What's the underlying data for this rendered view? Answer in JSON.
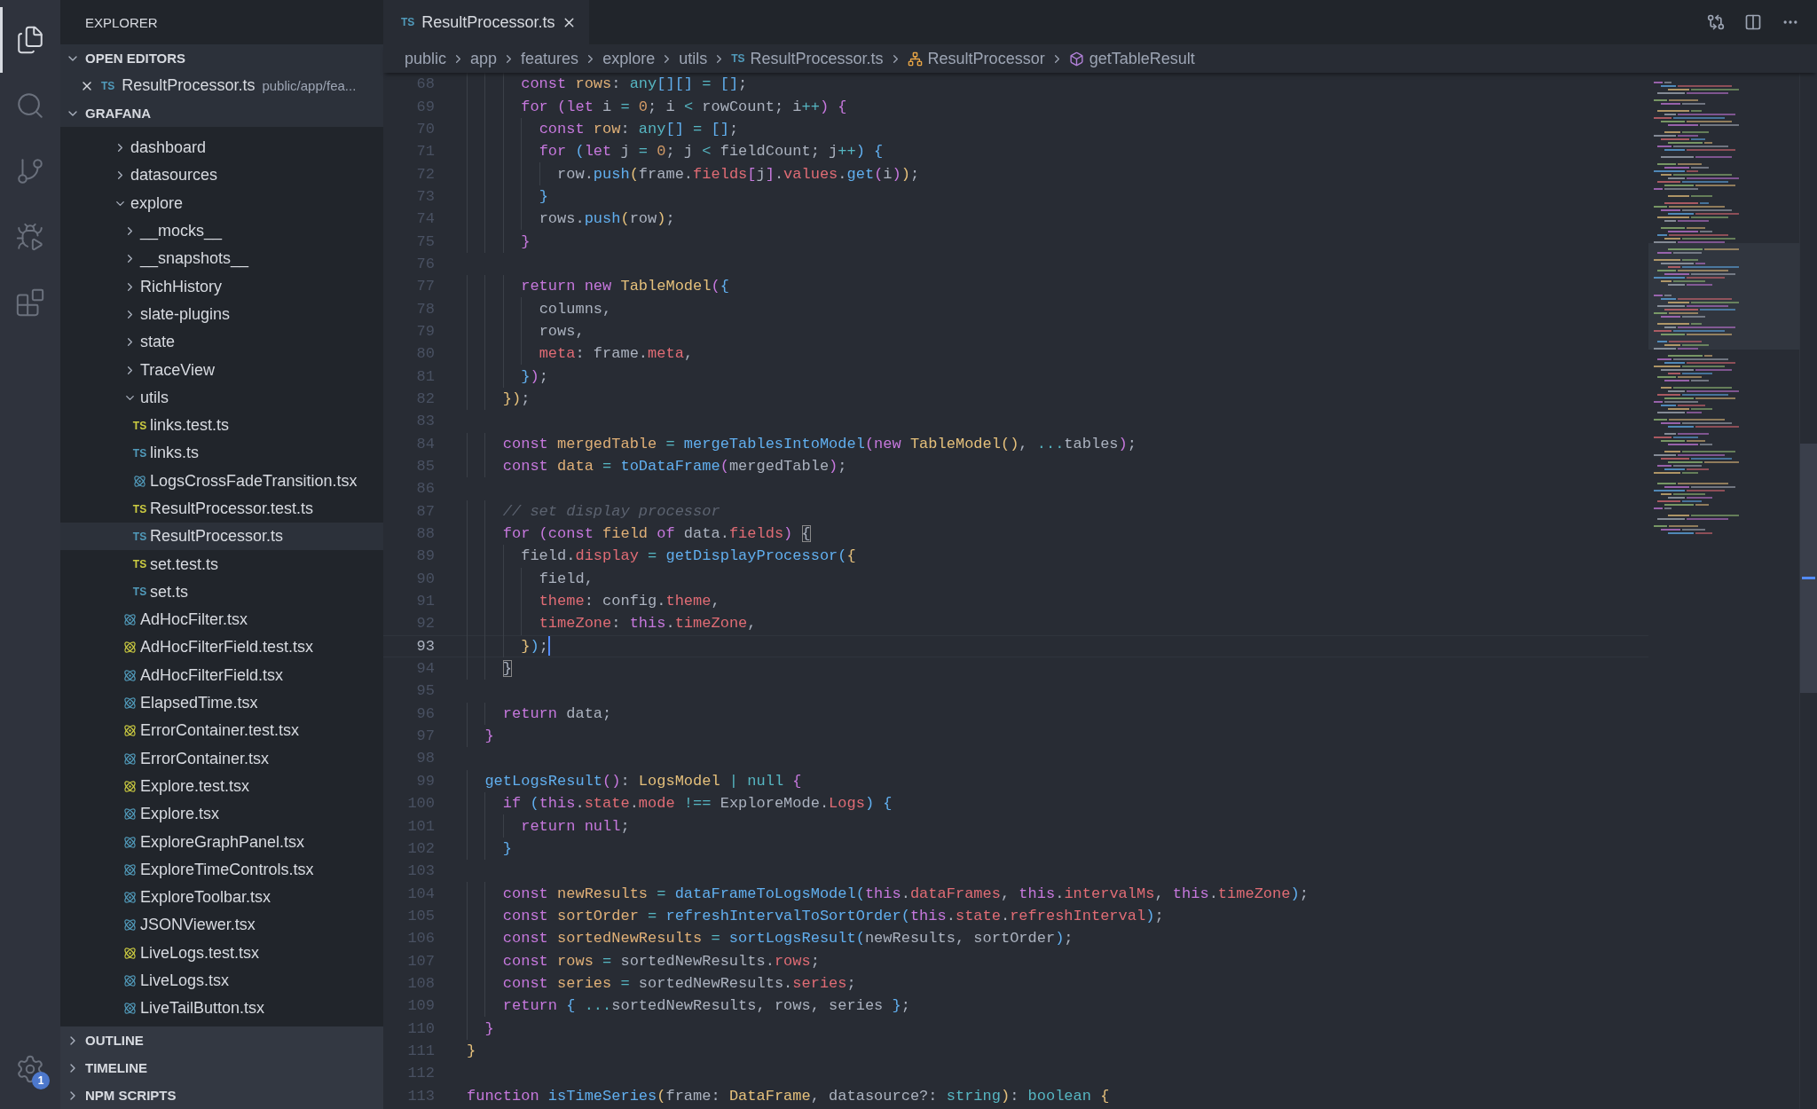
{
  "activity_bar": {
    "items": [
      {
        "kind": "files",
        "selected": true
      },
      {
        "kind": "search",
        "selected": false
      },
      {
        "kind": "source-control",
        "selected": false
      },
      {
        "kind": "run",
        "selected": false
      },
      {
        "kind": "extensions",
        "selected": false
      }
    ],
    "settings_badge": "1"
  },
  "sidebar": {
    "title": "EXPLORER",
    "sections": [
      {
        "kind": "open-editors",
        "title": "OPEN EDITORS",
        "expanded": true,
        "items": [
          {
            "badge": "TS",
            "name": "ResultProcessor.ts",
            "path": "public/app/fea..."
          }
        ]
      },
      {
        "kind": "tree",
        "title": "GRAFANA",
        "expanded": true,
        "tree": [
          {
            "kind": "folder",
            "name": "dashboard",
            "expanded": false,
            "selected": false
          },
          {
            "kind": "folder",
            "name": "datasources",
            "expanded": false,
            "selected": false
          },
          {
            "kind": "folder",
            "name": "explore",
            "expanded": true,
            "selected": false,
            "children": [
              {
                "kind": "folder",
                "name": "__mocks__",
                "expanded": false,
                "selected": false
              },
              {
                "kind": "folder",
                "name": "__snapshots__",
                "expanded": false,
                "selected": false
              },
              {
                "kind": "folder",
                "name": "RichHistory",
                "expanded": false,
                "selected": false
              },
              {
                "kind": "folder",
                "name": "slate-plugins",
                "expanded": false,
                "selected": false
              },
              {
                "kind": "folder",
                "name": "state",
                "expanded": false,
                "selected": false
              },
              {
                "kind": "folder",
                "name": "TraceView",
                "expanded": false,
                "selected": false
              },
              {
                "kind": "folder",
                "name": "utils",
                "expanded": true,
                "selected": false,
                "children": [
                  {
                    "kind": "ts-test",
                    "badge": "TS",
                    "name": "links.test.ts",
                    "selected": false
                  },
                  {
                    "kind": "ts",
                    "badge": "TS",
                    "name": "links.ts",
                    "selected": false
                  },
                  {
                    "kind": "tsx",
                    "name": "LogsCrossFadeTransition.tsx",
                    "selected": false
                  },
                  {
                    "kind": "ts-test",
                    "badge": "TS",
                    "name": "ResultProcessor.test.ts",
                    "selected": false
                  },
                  {
                    "kind": "ts",
                    "badge": "TS",
                    "name": "ResultProcessor.ts",
                    "selected": true
                  },
                  {
                    "kind": "ts-test",
                    "badge": "TS",
                    "name": "set.test.ts",
                    "selected": false
                  },
                  {
                    "kind": "ts",
                    "badge": "TS",
                    "name": "set.ts",
                    "selected": false
                  }
                ]
              },
              {
                "kind": "tsx",
                "name": "AdHocFilter.tsx",
                "selected": false
              },
              {
                "kind": "tsx-test",
                "name": "AdHocFilterField.test.tsx",
                "selected": false
              },
              {
                "kind": "tsx",
                "name": "AdHocFilterField.tsx",
                "selected": false
              },
              {
                "kind": "tsx",
                "name": "ElapsedTime.tsx",
                "selected": false
              },
              {
                "kind": "tsx-test",
                "name": "ErrorContainer.test.tsx",
                "selected": false
              },
              {
                "kind": "tsx",
                "name": "ErrorContainer.tsx",
                "selected": false
              },
              {
                "kind": "tsx-test",
                "name": "Explore.test.tsx",
                "selected": false
              },
              {
                "kind": "tsx",
                "name": "Explore.tsx",
                "selected": false
              },
              {
                "kind": "tsx",
                "name": "ExploreGraphPanel.tsx",
                "selected": false
              },
              {
                "kind": "tsx",
                "name": "ExploreTimeControls.tsx",
                "selected": false
              },
              {
                "kind": "tsx",
                "name": "ExploreToolbar.tsx",
                "selected": false
              },
              {
                "kind": "tsx",
                "name": "JSONViewer.tsx",
                "selected": false
              },
              {
                "kind": "tsx-test",
                "name": "LiveLogs.test.tsx",
                "selected": false
              },
              {
                "kind": "tsx",
                "name": "LiveLogs.tsx",
                "selected": false
              },
              {
                "kind": "tsx",
                "name": "LiveTailButton.tsx",
                "selected": false
              }
            ]
          }
        ]
      },
      {
        "kind": "panel",
        "title": "OUTLINE",
        "expanded": false
      },
      {
        "kind": "panel",
        "title": "TIMELINE",
        "expanded": false
      },
      {
        "kind": "panel",
        "title": "NPM SCRIPTS",
        "expanded": false
      }
    ]
  },
  "editor": {
    "tabs": [
      {
        "badge": "TS",
        "label": "ResultProcessor.ts",
        "selected": true
      }
    ],
    "breadcrumbs": [
      {
        "kind": "folder",
        "label": "public"
      },
      {
        "kind": "folder",
        "label": "app"
      },
      {
        "kind": "folder",
        "label": "features"
      },
      {
        "kind": "folder",
        "label": "explore"
      },
      {
        "kind": "folder",
        "label": "utils"
      },
      {
        "kind": "file",
        "badge": "TS",
        "label": "ResultProcessor.ts"
      },
      {
        "kind": "class",
        "label": "ResultProcessor"
      },
      {
        "kind": "method",
        "label": "getTableResult"
      }
    ],
    "lines": [
      {
        "number": "68",
        "tokens": [
          {
            "kind": "keyword",
            "text": "      const"
          },
          {
            "kind": "var",
            "text": " rows"
          },
          {
            "kind": "plain",
            "text": ": "
          },
          {
            "kind": "builtin",
            "text": "any"
          },
          {
            "kind": "paren2",
            "text": "[][]"
          },
          {
            "kind": "op",
            "text": " ="
          },
          {
            "kind": "paren2",
            "text": " []"
          },
          {
            "kind": "plain",
            "text": ";"
          }
        ]
      },
      {
        "number": "69",
        "tokens": [
          {
            "kind": "keyword",
            "text": "      for"
          },
          {
            "kind": "paren1",
            "text": " ("
          },
          {
            "kind": "keyword",
            "text": "let"
          },
          {
            "kind": "plain",
            "text": " i "
          },
          {
            "kind": "op",
            "text": "="
          },
          {
            "kind": "num",
            "text": " 0"
          },
          {
            "kind": "plain",
            "text": "; i "
          },
          {
            "kind": "op",
            "text": "<"
          },
          {
            "kind": "plain",
            "text": " rowCount; i"
          },
          {
            "kind": "op",
            "text": "++"
          },
          {
            "kind": "paren1",
            "text": ")"
          },
          {
            "kind": "paren1",
            "text": " {"
          }
        ]
      },
      {
        "number": "70",
        "tokens": [
          {
            "kind": "keyword",
            "text": "        const"
          },
          {
            "kind": "var",
            "text": " row"
          },
          {
            "kind": "plain",
            "text": ": "
          },
          {
            "kind": "builtin",
            "text": "any"
          },
          {
            "kind": "paren2",
            "text": "[]"
          },
          {
            "kind": "op",
            "text": " ="
          },
          {
            "kind": "paren2",
            "text": " []"
          },
          {
            "kind": "plain",
            "text": ";"
          }
        ]
      },
      {
        "number": "71",
        "tokens": [
          {
            "kind": "keyword",
            "text": "        for"
          },
          {
            "kind": "paren2",
            "text": " ("
          },
          {
            "kind": "keyword",
            "text": "let"
          },
          {
            "kind": "plain",
            "text": " j "
          },
          {
            "kind": "op",
            "text": "="
          },
          {
            "kind": "num",
            "text": " 0"
          },
          {
            "kind": "plain",
            "text": "; j "
          },
          {
            "kind": "op",
            "text": "<"
          },
          {
            "kind": "plain",
            "text": " fieldCount; j"
          },
          {
            "kind": "op",
            "text": "++"
          },
          {
            "kind": "paren2",
            "text": ")"
          },
          {
            "kind": "paren2",
            "text": " {"
          }
        ]
      },
      {
        "number": "72",
        "tokens": [
          {
            "kind": "plain",
            "text": "          row."
          },
          {
            "kind": "func",
            "text": "push"
          },
          {
            "kind": "paren3",
            "text": "("
          },
          {
            "kind": "plain",
            "text": "frame."
          },
          {
            "kind": "prop",
            "text": "fields"
          },
          {
            "kind": "paren1",
            "text": "["
          },
          {
            "kind": "plain",
            "text": "j"
          },
          {
            "kind": "paren1",
            "text": "]"
          },
          {
            "kind": "plain",
            "text": "."
          },
          {
            "kind": "prop",
            "text": "values"
          },
          {
            "kind": "plain",
            "text": "."
          },
          {
            "kind": "func",
            "text": "get"
          },
          {
            "kind": "paren1",
            "text": "("
          },
          {
            "kind": "plain",
            "text": "i"
          },
          {
            "kind": "paren1",
            "text": ")"
          },
          {
            "kind": "paren3",
            "text": ")"
          },
          {
            "kind": "plain",
            "text": ";"
          }
        ]
      },
      {
        "number": "73",
        "tokens": [
          {
            "kind": "paren2",
            "text": "        }"
          }
        ]
      },
      {
        "number": "74",
        "tokens": [
          {
            "kind": "plain",
            "text": "        rows."
          },
          {
            "kind": "func",
            "text": "push"
          },
          {
            "kind": "paren3",
            "text": "("
          },
          {
            "kind": "plain",
            "text": "row"
          },
          {
            "kind": "paren3",
            "text": ")"
          },
          {
            "kind": "plain",
            "text": ";"
          }
        ]
      },
      {
        "number": "75",
        "tokens": [
          {
            "kind": "paren1",
            "text": "      }"
          }
        ]
      },
      {
        "number": "76"
      },
      {
        "number": "77",
        "tokens": [
          {
            "kind": "keyword",
            "text": "      return"
          },
          {
            "kind": "keyword",
            "text": " new"
          },
          {
            "kind": "type",
            "text": " TableModel"
          },
          {
            "kind": "paren1",
            "text": "("
          },
          {
            "kind": "paren2",
            "text": "{"
          }
        ]
      },
      {
        "number": "78",
        "tokens": [
          {
            "kind": "plain",
            "text": "        columns,"
          }
        ]
      },
      {
        "number": "79",
        "tokens": [
          {
            "kind": "plain",
            "text": "        rows,"
          }
        ]
      },
      {
        "number": "80",
        "tokens": [
          {
            "kind": "prop",
            "text": "        meta"
          },
          {
            "kind": "plain",
            "text": ": frame."
          },
          {
            "kind": "prop",
            "text": "meta"
          },
          {
            "kind": "plain",
            "text": ","
          }
        ]
      },
      {
        "number": "81",
        "tokens": [
          {
            "kind": "paren2",
            "text": "      }"
          },
          {
            "kind": "paren1",
            "text": ")"
          },
          {
            "kind": "plain",
            "text": ";"
          }
        ]
      },
      {
        "number": "82",
        "tokens": [
          {
            "kind": "paren3",
            "text": "    })"
          },
          {
            "kind": "plain",
            "text": ";"
          }
        ]
      },
      {
        "number": "83"
      },
      {
        "number": "84",
        "tokens": [
          {
            "kind": "keyword",
            "text": "    const"
          },
          {
            "kind": "var",
            "text": " mergedTable"
          },
          {
            "kind": "op",
            "text": " ="
          },
          {
            "kind": "func",
            "text": " mergeTablesIntoModel"
          },
          {
            "kind": "paren1",
            "text": "("
          },
          {
            "kind": "keyword",
            "text": "new"
          },
          {
            "kind": "type",
            "text": " TableModel"
          },
          {
            "kind": "paren3",
            "text": "()"
          },
          {
            "kind": "plain",
            "text": ", "
          },
          {
            "kind": "op",
            "text": "..."
          },
          {
            "kind": "plain",
            "text": "tables"
          },
          {
            "kind": "paren1",
            "text": ")"
          },
          {
            "kind": "plain",
            "text": ";"
          }
        ]
      },
      {
        "number": "85",
        "tokens": [
          {
            "kind": "keyword",
            "text": "    const"
          },
          {
            "kind": "var",
            "text": " data"
          },
          {
            "kind": "op",
            "text": " ="
          },
          {
            "kind": "func",
            "text": " toDataFrame"
          },
          {
            "kind": "paren1",
            "text": "("
          },
          {
            "kind": "plain",
            "text": "mergedTable"
          },
          {
            "kind": "paren1",
            "text": ")"
          },
          {
            "kind": "plain",
            "text": ";"
          }
        ]
      },
      {
        "number": "86"
      },
      {
        "number": "87",
        "tokens": [
          {
            "kind": "comment",
            "text": "    // set display processor"
          }
        ]
      },
      {
        "number": "88",
        "tokens": [
          {
            "kind": "keyword",
            "text": "    for"
          },
          {
            "kind": "paren1",
            "text": " ("
          },
          {
            "kind": "keyword",
            "text": "const"
          },
          {
            "kind": "var",
            "text": " field"
          },
          {
            "kind": "keyword",
            "text": " of"
          },
          {
            "kind": "plain",
            "text": " data."
          },
          {
            "kind": "prop",
            "text": "fields"
          },
          {
            "kind": "paren1",
            "text": ") "
          },
          {
            "kind": "match",
            "text": "{"
          }
        ]
      },
      {
        "number": "89",
        "tokens": [
          {
            "kind": "plain",
            "text": "      field."
          },
          {
            "kind": "prop",
            "text": "display"
          },
          {
            "kind": "op",
            "text": " ="
          },
          {
            "kind": "func",
            "text": " getDisplayProcessor"
          },
          {
            "kind": "paren2",
            "text": "("
          },
          {
            "kind": "paren3",
            "text": "{"
          }
        ]
      },
      {
        "number": "90",
        "tokens": [
          {
            "kind": "plain",
            "text": "        field,"
          }
        ]
      },
      {
        "number": "91",
        "tokens": [
          {
            "kind": "prop",
            "text": "        theme"
          },
          {
            "kind": "plain",
            "text": ": config."
          },
          {
            "kind": "prop",
            "text": "theme"
          },
          {
            "kind": "plain",
            "text": ","
          }
        ]
      },
      {
        "number": "92",
        "tokens": [
          {
            "kind": "prop",
            "text": "        timeZone"
          },
          {
            "kind": "plain",
            "text": ": "
          },
          {
            "kind": "keyword",
            "text": "this"
          },
          {
            "kind": "plain",
            "text": "."
          },
          {
            "kind": "prop",
            "text": "timeZone"
          },
          {
            "kind": "plain",
            "text": ","
          }
        ]
      },
      {
        "number": "93",
        "current": true,
        "tokens": [
          {
            "kind": "paren3",
            "text": "      }"
          },
          {
            "kind": "paren2",
            "text": ")"
          },
          {
            "kind": "plain",
            "text": ";"
          }
        ]
      },
      {
        "number": "94",
        "tokens": [
          {
            "kind": "match",
            "text": "    }"
          }
        ]
      },
      {
        "number": "95"
      },
      {
        "number": "96",
        "tokens": [
          {
            "kind": "keyword",
            "text": "    return"
          },
          {
            "kind": "plain",
            "text": " data;"
          }
        ]
      },
      {
        "number": "97",
        "tokens": [
          {
            "kind": "paren1",
            "text": "  }"
          }
        ]
      },
      {
        "number": "98"
      },
      {
        "number": "99",
        "tokens": [
          {
            "kind": "func",
            "text": "  getLogsResult"
          },
          {
            "kind": "paren1",
            "text": "()"
          },
          {
            "kind": "plain",
            "text": ": "
          },
          {
            "kind": "type",
            "text": "LogsModel"
          },
          {
            "kind": "op",
            "text": " |"
          },
          {
            "kind": "builtin",
            "text": " null"
          },
          {
            "kind": "paren1",
            "text": " {"
          }
        ]
      },
      {
        "number": "100",
        "tokens": [
          {
            "kind": "keyword",
            "text": "    if"
          },
          {
            "kind": "paren2",
            "text": " ("
          },
          {
            "kind": "keyword",
            "text": "this"
          },
          {
            "kind": "plain",
            "text": "."
          },
          {
            "kind": "prop",
            "text": "state"
          },
          {
            "kind": "plain",
            "text": "."
          },
          {
            "kind": "prop",
            "text": "mode"
          },
          {
            "kind": "op",
            "text": " !=="
          },
          {
            "kind": "plain",
            "text": " ExploreMode."
          },
          {
            "kind": "prop",
            "text": "Logs"
          },
          {
            "kind": "paren2",
            "text": ")"
          },
          {
            "kind": "paren2",
            "text": " {"
          }
        ]
      },
      {
        "number": "101",
        "tokens": [
          {
            "kind": "keyword",
            "text": "      return"
          },
          {
            "kind": "keyword",
            "text": " null"
          },
          {
            "kind": "plain",
            "text": ";"
          }
        ]
      },
      {
        "number": "102",
        "tokens": [
          {
            "kind": "paren2",
            "text": "    }"
          }
        ]
      },
      {
        "number": "103"
      },
      {
        "number": "104",
        "tokens": [
          {
            "kind": "keyword",
            "text": "    const"
          },
          {
            "kind": "var",
            "text": " newResults"
          },
          {
            "kind": "op",
            "text": " ="
          },
          {
            "kind": "func",
            "text": " dataFrameToLogsModel"
          },
          {
            "kind": "paren2",
            "text": "("
          },
          {
            "kind": "keyword",
            "text": "this"
          },
          {
            "kind": "plain",
            "text": "."
          },
          {
            "kind": "prop",
            "text": "dataFrames"
          },
          {
            "kind": "plain",
            "text": ", "
          },
          {
            "kind": "keyword",
            "text": "this"
          },
          {
            "kind": "plain",
            "text": "."
          },
          {
            "kind": "prop",
            "text": "intervalMs"
          },
          {
            "kind": "plain",
            "text": ", "
          },
          {
            "kind": "keyword",
            "text": "this"
          },
          {
            "kind": "plain",
            "text": "."
          },
          {
            "kind": "prop",
            "text": "timeZone"
          },
          {
            "kind": "paren2",
            "text": ")"
          },
          {
            "kind": "plain",
            "text": ";"
          }
        ]
      },
      {
        "number": "105",
        "tokens": [
          {
            "kind": "keyword",
            "text": "    const"
          },
          {
            "kind": "var",
            "text": " sortOrder"
          },
          {
            "kind": "op",
            "text": " ="
          },
          {
            "kind": "func",
            "text": " refreshIntervalToSortOrder"
          },
          {
            "kind": "paren2",
            "text": "("
          },
          {
            "kind": "keyword",
            "text": "this"
          },
          {
            "kind": "plain",
            "text": "."
          },
          {
            "kind": "prop",
            "text": "state"
          },
          {
            "kind": "plain",
            "text": "."
          },
          {
            "kind": "prop",
            "text": "refreshInterval"
          },
          {
            "kind": "paren2",
            "text": ")"
          },
          {
            "kind": "plain",
            "text": ";"
          }
        ]
      },
      {
        "number": "106",
        "tokens": [
          {
            "kind": "keyword",
            "text": "    const"
          },
          {
            "kind": "var",
            "text": " sortedNewResults"
          },
          {
            "kind": "op",
            "text": " ="
          },
          {
            "kind": "func",
            "text": " sortLogsResult"
          },
          {
            "kind": "paren2",
            "text": "("
          },
          {
            "kind": "plain",
            "text": "newResults, sortOrder"
          },
          {
            "kind": "paren2",
            "text": ")"
          },
          {
            "kind": "plain",
            "text": ";"
          }
        ]
      },
      {
        "number": "107",
        "tokens": [
          {
            "kind": "keyword",
            "text": "    const"
          },
          {
            "kind": "var",
            "text": " rows"
          },
          {
            "kind": "op",
            "text": " ="
          },
          {
            "kind": "plain",
            "text": " sortedNewResults."
          },
          {
            "kind": "prop",
            "text": "rows"
          },
          {
            "kind": "plain",
            "text": ";"
          }
        ]
      },
      {
        "number": "108",
        "tokens": [
          {
            "kind": "keyword",
            "text": "    const"
          },
          {
            "kind": "var",
            "text": " series"
          },
          {
            "kind": "op",
            "text": " ="
          },
          {
            "kind": "plain",
            "text": " sortedNewResults."
          },
          {
            "kind": "prop",
            "text": "series"
          },
          {
            "kind": "plain",
            "text": ";"
          }
        ]
      },
      {
        "number": "109",
        "tokens": [
          {
            "kind": "keyword",
            "text": "    return"
          },
          {
            "kind": "paren2",
            "text": " {"
          },
          {
            "kind": "op",
            "text": " ..."
          },
          {
            "kind": "plain",
            "text": "sortedNewResults, rows, series "
          },
          {
            "kind": "paren2",
            "text": "}"
          },
          {
            "kind": "plain",
            "text": ";"
          }
        ]
      },
      {
        "number": "110",
        "tokens": [
          {
            "kind": "paren1",
            "text": "  }"
          }
        ]
      },
      {
        "number": "111",
        "tokens": [
          {
            "kind": "paren3",
            "text": "}"
          }
        ]
      },
      {
        "number": "112"
      },
      {
        "number": "113",
        "tokens": [
          {
            "kind": "keyword",
            "text": "function"
          },
          {
            "kind": "func",
            "text": " isTimeSeries"
          },
          {
            "kind": "paren3",
            "text": "("
          },
          {
            "kind": "plain",
            "text": "frame: "
          },
          {
            "kind": "type",
            "text": "DataFrame"
          },
          {
            "kind": "plain",
            "text": ", datasource?: "
          },
          {
            "kind": "builtin",
            "text": "string"
          },
          {
            "kind": "paren3",
            "text": ")"
          },
          {
            "kind": "plain",
            "text": ": "
          },
          {
            "kind": "builtin",
            "text": "boolean"
          },
          {
            "kind": "paren3",
            "text": " {"
          }
        ]
      }
    ]
  }
}
